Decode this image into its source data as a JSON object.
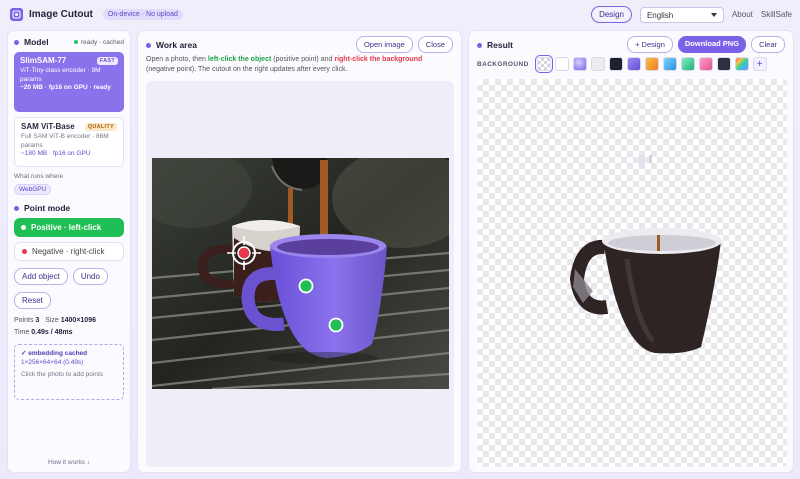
{
  "app": {
    "title": "Image Cutout",
    "badge": "On-device · No upload"
  },
  "topbar": {
    "design_label": "Design",
    "language": "English",
    "about": "About",
    "brand": "SkillSafe"
  },
  "model": {
    "heading": "Model",
    "status": "ready · cached",
    "cards": [
      {
        "name": "SlimSAM-77",
        "badge": "FAST",
        "desc": "ViT-Tiny-class encoder · 9M params",
        "stat": "~20 MB · fp16 on GPU · ready"
      },
      {
        "name": "SAM ViT-Base",
        "badge": "QUALITY",
        "desc": "Full SAM ViT-B encoder · 86M params",
        "stat": "~180 MB · fp16 on GPU"
      }
    ],
    "runs_label": "What runs where",
    "runtime": "WebGPU"
  },
  "point_mode": {
    "heading": "Point mode",
    "positive": "Positive · left-click",
    "negative": "Negative · right-click",
    "add_object": "Add object",
    "undo": "Undo",
    "reset": "Reset",
    "points_label": "Points",
    "points_value": "3",
    "size_label": "Size",
    "size_value": "1400×1096",
    "time_label": "Time",
    "time_value": "0.49s / 48ms",
    "cache_line1": "✓ embedding cached",
    "cache_line2": "1×256×64×64 (0.49s)",
    "cache_hint": "Click the photo to add points",
    "how_it_works": "How it works ↓"
  },
  "work_area": {
    "heading": "Work area",
    "open_image": "Open image",
    "close": "Close",
    "instr_a": "Open a photo, then ",
    "instr_pos": "left-click the object",
    "instr_b": " (positive point) and ",
    "instr_neg": "right-click the background",
    "instr_c": " (negative point). The cutout on the right updates after every click."
  },
  "result": {
    "heading": "Result",
    "design": "+ Design",
    "download": "Download PNG",
    "clear": "Clear",
    "background_label": "BACKGROUND",
    "swatches": [
      "transparent",
      "#ffffff",
      "#9a86f0",
      "#eeeeee",
      "#1e2130",
      "#7b61e8",
      "#f4a23a",
      "#3fb6f0",
      "#3ecf9a",
      "#f07ab2",
      "#2d3040",
      "rainbow"
    ]
  },
  "colors": {
    "accent": "#7b61e8",
    "positive": "#1fbf55",
    "negative": "#e5394a"
  }
}
